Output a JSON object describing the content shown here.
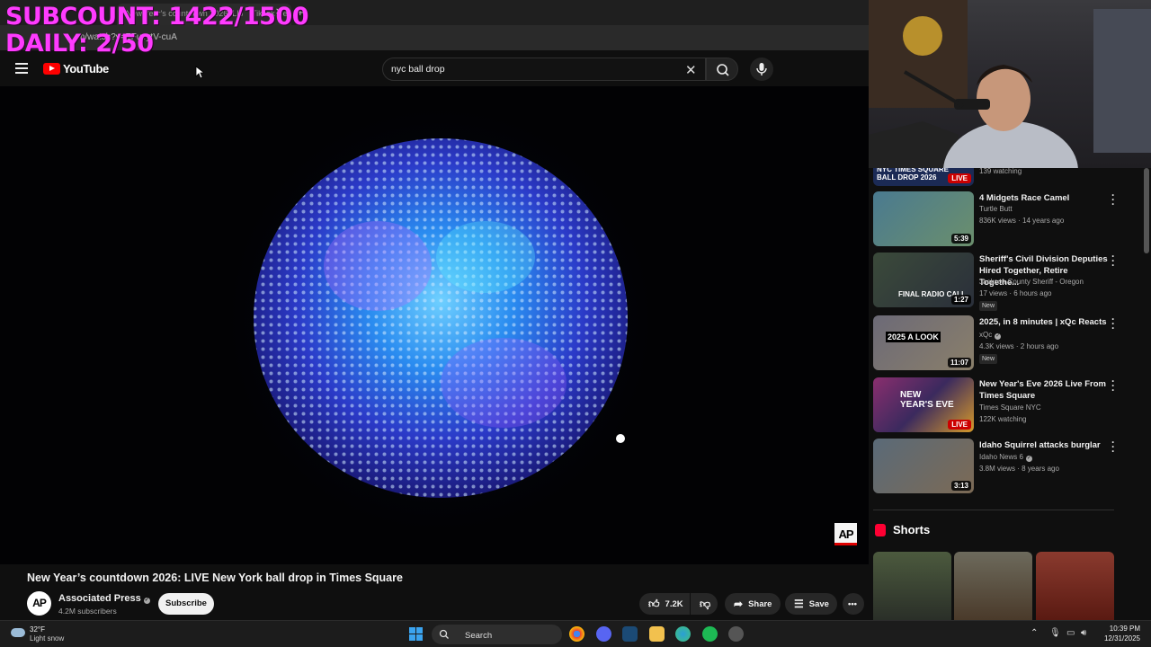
{
  "overlay": {
    "subcount": "SUBCOUNT: 1422/1500",
    "daily": "DAILY: 2/50"
  },
  "browser": {
    "tabs": [
      {
        "label": "New Year's countdown 2026: LIVE N…"
      },
      {
        "label": "TikTok De…",
        "close": "✕"
      }
    ],
    "new_tab": "+",
    "url": "m/watch?v=ZFuvytV-cuA"
  },
  "youtube": {
    "logo_text": "YouTube",
    "search": {
      "value": "nyc ball drop",
      "clear_icon": "clear-icon"
    },
    "video": {
      "title": "New Year’s countdown 2026: LIVE New York ball drop in Times Square",
      "watermark": "AP",
      "channel": {
        "avatar": "AP",
        "name": "Associated Press",
        "subscribers": "4.2M subscribers",
        "subscribe_label": "Subscribe"
      },
      "actions": {
        "like_count": "7.2K",
        "share_label": "Share",
        "save_label": "Save"
      }
    },
    "recommendations": [
      {
        "title": "NYC TIMES SQUARE BALL DROP 2026",
        "meta": "139 watching",
        "badge": "LIVE",
        "thumb_color": "#1b2a55"
      },
      {
        "title": "4 Midgets Race Camel",
        "channel": "Turtle Butt",
        "meta": "836K views · 14 years ago",
        "duration": "5:39",
        "thumb_color": "#4a7a90"
      },
      {
        "title": "Sheriff's Civil Division Deputies Hired Together, Retire Togethe...",
        "channel": "Jackson County Sheriff - Oregon",
        "meta": "17 views · 6 hours ago",
        "new": "New",
        "duration": "1:27",
        "thumb_color": "#3b4a3a",
        "thumb_text": "FINAL RADIO CALL"
      },
      {
        "title": "2025, in 8 minutes | xQc Reacts",
        "channel": "xQc",
        "verified": true,
        "meta": "4.3K views · 2 hours ago",
        "new": "New",
        "duration": "11:07",
        "thumb_color": "#6c6a77",
        "thumb_text": "2025 A LOOK"
      },
      {
        "title": "New Year's Eve 2026 Live From Times Square",
        "channel": "Times Square NYC",
        "meta": "122K watching",
        "badge": "LIVE",
        "thumb_color": "#3b2a5e",
        "thumb_text": "NEW YEAR'S EVE"
      },
      {
        "title": "Idaho Squirrel attacks burglar",
        "channel": "Idaho News 6",
        "verified": true,
        "meta": "3.8M views · 8 years ago",
        "duration": "3:13",
        "thumb_color": "#5a6a78"
      }
    ],
    "shorts": {
      "label": "Shorts",
      "items": [
        {
          "color": "#4c5a3e"
        },
        {
          "color": "#6d6a5c"
        },
        {
          "color": "#8a3a2e"
        }
      ]
    }
  },
  "taskbar": {
    "weather_temp": "32°F",
    "weather_desc": "Light snow",
    "search_label": "Search",
    "time": "10:39 PM",
    "date": "12/31/2025",
    "apps": [
      {
        "icon": "chrome-icon",
        "color": "#e8b43a"
      },
      {
        "icon": "discord-icon",
        "color": "#5865f2"
      },
      {
        "icon": "steam-icon",
        "color": "#1b4a75"
      },
      {
        "icon": "file-explorer-icon",
        "color": "#f2c14e"
      },
      {
        "icon": "edge-icon",
        "color": "#2a9ed8"
      },
      {
        "icon": "spotify-icon",
        "color": "#1db954"
      },
      {
        "icon": "obs-icon",
        "color": "#555555"
      }
    ]
  }
}
